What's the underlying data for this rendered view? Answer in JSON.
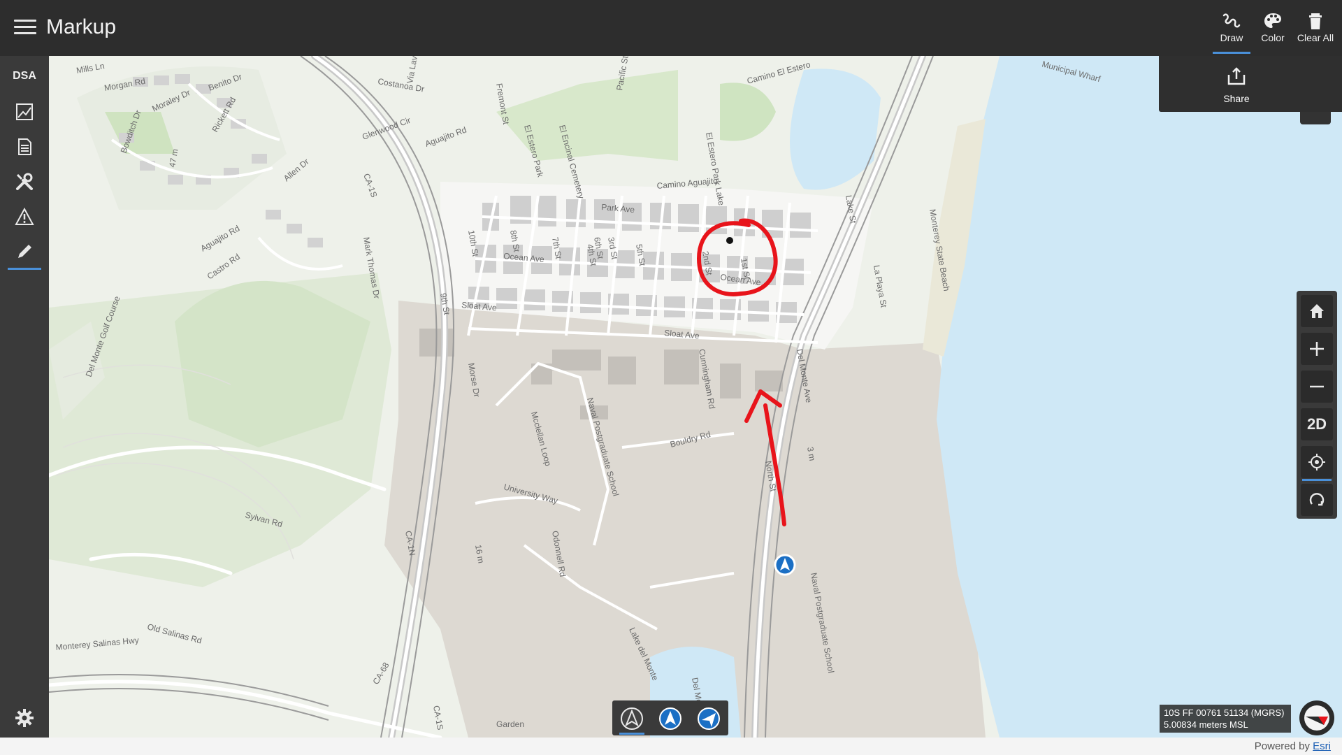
{
  "app": {
    "title": "Markup"
  },
  "toolbar": {
    "draw_label": "Draw",
    "color_label": "Color",
    "clear_all_label": "Clear All",
    "share_label": "Share"
  },
  "sidebar": {
    "dsa_label": "DSA",
    "items": [
      {
        "name": "map-layers-icon"
      },
      {
        "name": "document-icon"
      },
      {
        "name": "tools-icon"
      },
      {
        "name": "warning-icon"
      },
      {
        "name": "pencil-icon"
      }
    ]
  },
  "nav_tools": {
    "mode_2d_label": "2D"
  },
  "status": {
    "coordinates": "10S FF 00761 51134 (MGRS)",
    "elevation": "5.00834 meters MSL"
  },
  "attribution": {
    "prefix": "Powered by ",
    "link": "Esri"
  },
  "map_labels": {
    "streets": [
      "Mills Ln",
      "Morgan Rd",
      "Benito Dr",
      "Moraley Dr",
      "Bowditch Dr",
      "47 m",
      "Rickett Rd",
      "Allen Dr",
      "Aguajito Rd",
      "Castro Rd",
      "Costanoa Dr",
      "Via Lavandera",
      "Glenwood Cir",
      "Aguajito Rd",
      "CA-1S",
      "Mark Thomas Dr",
      "Fremont St",
      "El Estero Park",
      "El Encinal Cemetery",
      "Pacific St",
      "El Estero Park Lake",
      "Camino El Estero",
      "Camino Aguajito",
      "10th St",
      "9th St",
      "8th St",
      "7th St",
      "6th St",
      "5th St",
      "4th St",
      "3rd St",
      "2nd St",
      "1st St",
      "Park Ave",
      "Ocean Ave",
      "Ocean Ave",
      "Sloat Ave",
      "Sloat Ave",
      "Lake St",
      "La Playa St",
      "Monterey State Beach",
      "Del Monte Golf Course",
      "Morse Dr",
      "Cunningham Rd",
      "Naval Postgraduate School",
      "Mcclellan Loop",
      "University Way",
      "Bouldry Rd",
      "Del Monte Ave",
      "North St",
      "3 m",
      "Odonnell Rd",
      "Sylvan Rd",
      "16 m",
      "Naval Postgraduate School",
      "Lake del Monte",
      "Monterey Salinas Hwy",
      "Old Salinas Rd",
      "CA-68",
      "CA-1N",
      "CA-1S",
      "Garden",
      "Municipal Wharf",
      "Del Monte Lake"
    ]
  },
  "annotations": {
    "circle_color": "#e8141b",
    "arrow_color": "#e8141b",
    "accent": "#4a90d9"
  }
}
